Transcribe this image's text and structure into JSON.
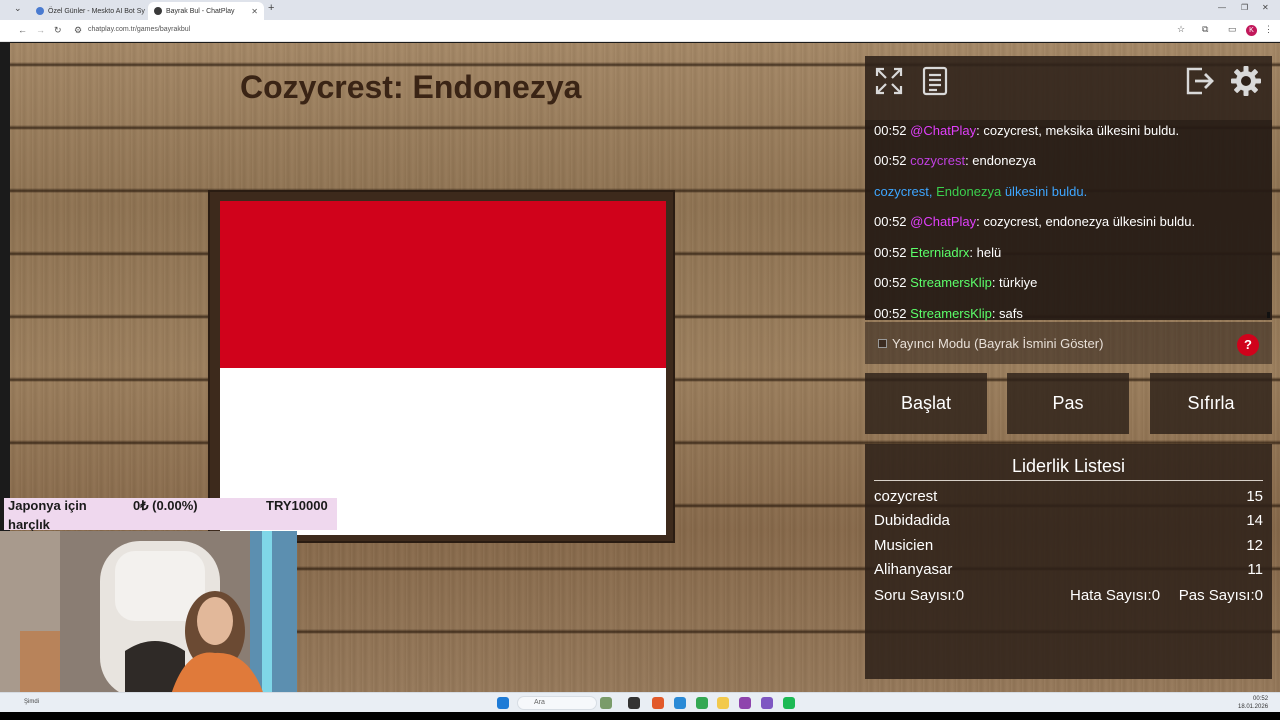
{
  "browser": {
    "tabs": [
      {
        "title": "Özel Günler - Meskto AI Bot Sy",
        "active": false
      },
      {
        "title": "Bayrak Bul - ChatPlay",
        "active": true
      }
    ],
    "url": "chatplay.com.tr/games/bayrakbul"
  },
  "game": {
    "title": "Cozycrest: Endonezya",
    "flag": {
      "top_color": "#d0021b",
      "bottom_color": "#ffffff"
    }
  },
  "chat": [
    {
      "time": "00:52",
      "user": "@ChatPlay",
      "user_color": "#e040fb",
      "text": ": cozycrest, meksika ülkesini buldu."
    },
    {
      "time": "00:52",
      "user": "cozycrest",
      "user_color": "#c040e0",
      "text": ": endonezya"
    },
    {
      "announce_user": "cozycrest,",
      "announce_country": "Endonezya",
      "announce_text": "ülkesini buldu."
    },
    {
      "time": "00:52",
      "user": "@ChatPlay",
      "user_color": "#e040fb",
      "text": ": cozycrest, endonezya ülkesini buldu."
    },
    {
      "time": "00:52",
      "user": "Eterniadrx",
      "user_color": "#5cff6a",
      "text": ": helü"
    },
    {
      "time": "00:52",
      "user": "StreamersKlip",
      "user_color": "#5cff6a",
      "text": ": türkiye"
    },
    {
      "time": "00:52",
      "user": "StreamersKlip",
      "user_color": "#5cff6a",
      "text": ": safs"
    }
  ],
  "mode": {
    "label": "Yayıncı Modu (Bayrak İsmini Göster)",
    "checked": false,
    "help": "?"
  },
  "controls": {
    "start": "Başlat",
    "pass": "Pas",
    "reset": "Sıfırla"
  },
  "leaderboard": {
    "title": "Liderlik Listesi",
    "rows": [
      {
        "name": "cozycrest",
        "score": "15"
      },
      {
        "name": "Dubidadida",
        "score": "14"
      },
      {
        "name": "Musicien",
        "score": "12"
      },
      {
        "name": "Alihanyasar",
        "score": "11"
      }
    ],
    "stats": {
      "questions": "Soru Sayısı:0",
      "errors": "Hata Sayısı:0",
      "passes": "Pas Sayısı:0"
    }
  },
  "donation": {
    "label_line1": "Japonya için",
    "label_line2": "harçlık",
    "progress": "0₺ (0.00%)",
    "goal": "TRY10000"
  },
  "taskbar": {
    "search": "Ara",
    "time": "00:52",
    "date": "18.01.2026",
    "weather": "Şimdi"
  },
  "colors": {
    "announce_user": "#3ea6ff",
    "announce_country": "#3ccf4e",
    "announce_text": "#3ea6ff",
    "help_red": "#d0021b"
  }
}
